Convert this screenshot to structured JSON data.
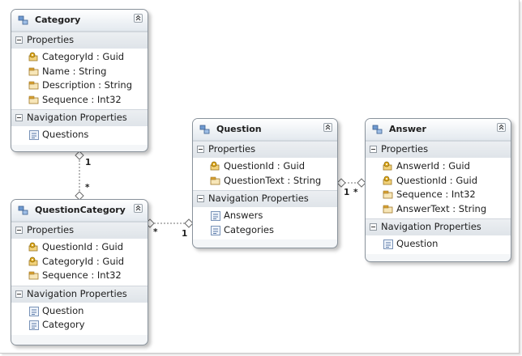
{
  "colors": {
    "border": "#8a939c",
    "header_gradient_top": "#ffffff",
    "header_gradient_bottom": "#e3e9ef",
    "section_header": "#e4e8ec",
    "key_icon": "#e0a818",
    "property_icon": "#d8a030",
    "navigation_icon": "#5a7aa8",
    "connector": "#707070"
  },
  "entities": {
    "category": {
      "name": "Category",
      "properties_label": "Properties",
      "properties": [
        {
          "text": "CategoryId : Guid",
          "icon": "key-property-icon"
        },
        {
          "text": "Name : String",
          "icon": "property-icon"
        },
        {
          "text": "Description : String",
          "icon": "property-icon"
        },
        {
          "text": "Sequence : Int32",
          "icon": "property-icon"
        }
      ],
      "navigation_label": "Navigation Properties",
      "navigation": [
        {
          "text": "Questions",
          "icon": "navigation-property-icon"
        }
      ]
    },
    "question_category": {
      "name": "QuestionCategory",
      "properties_label": "Properties",
      "properties": [
        {
          "text": "QuestionId : Guid",
          "icon": "key-property-icon"
        },
        {
          "text": "CategoryId : Guid",
          "icon": "key-property-icon"
        },
        {
          "text": "Sequence : Int32",
          "icon": "property-icon"
        }
      ],
      "navigation_label": "Navigation Properties",
      "navigation": [
        {
          "text": "Question",
          "icon": "navigation-property-icon"
        },
        {
          "text": "Category",
          "icon": "navigation-property-icon"
        }
      ]
    },
    "question": {
      "name": "Question",
      "properties_label": "Properties",
      "properties": [
        {
          "text": "QuestionId : Guid",
          "icon": "key-property-icon"
        },
        {
          "text": "QuestionText : String",
          "icon": "property-icon"
        }
      ],
      "navigation_label": "Navigation Properties",
      "navigation": [
        {
          "text": "Answers",
          "icon": "navigation-property-icon"
        },
        {
          "text": "Categories",
          "icon": "navigation-property-icon"
        }
      ]
    },
    "answer": {
      "name": "Answer",
      "properties_label": "Properties",
      "properties": [
        {
          "text": "AnswerId : Guid",
          "icon": "key-property-icon"
        },
        {
          "text": "QuestionId : Guid",
          "icon": "key-property-icon"
        },
        {
          "text": "Sequence : Int32",
          "icon": "property-icon"
        },
        {
          "text": "AnswerText : String",
          "icon": "property-icon"
        }
      ],
      "navigation_label": "Navigation Properties",
      "navigation": [
        {
          "text": "Question",
          "icon": "navigation-property-icon"
        }
      ]
    }
  },
  "associations": [
    {
      "from": "Category",
      "to": "QuestionCategory",
      "from_multiplicity": "1",
      "to_multiplicity": "*"
    },
    {
      "from": "QuestionCategory",
      "to": "Question",
      "from_multiplicity": "*",
      "to_multiplicity": "1"
    },
    {
      "from": "Question",
      "to": "Answer",
      "from_multiplicity": "1",
      "to_multiplicity": "*"
    }
  ]
}
